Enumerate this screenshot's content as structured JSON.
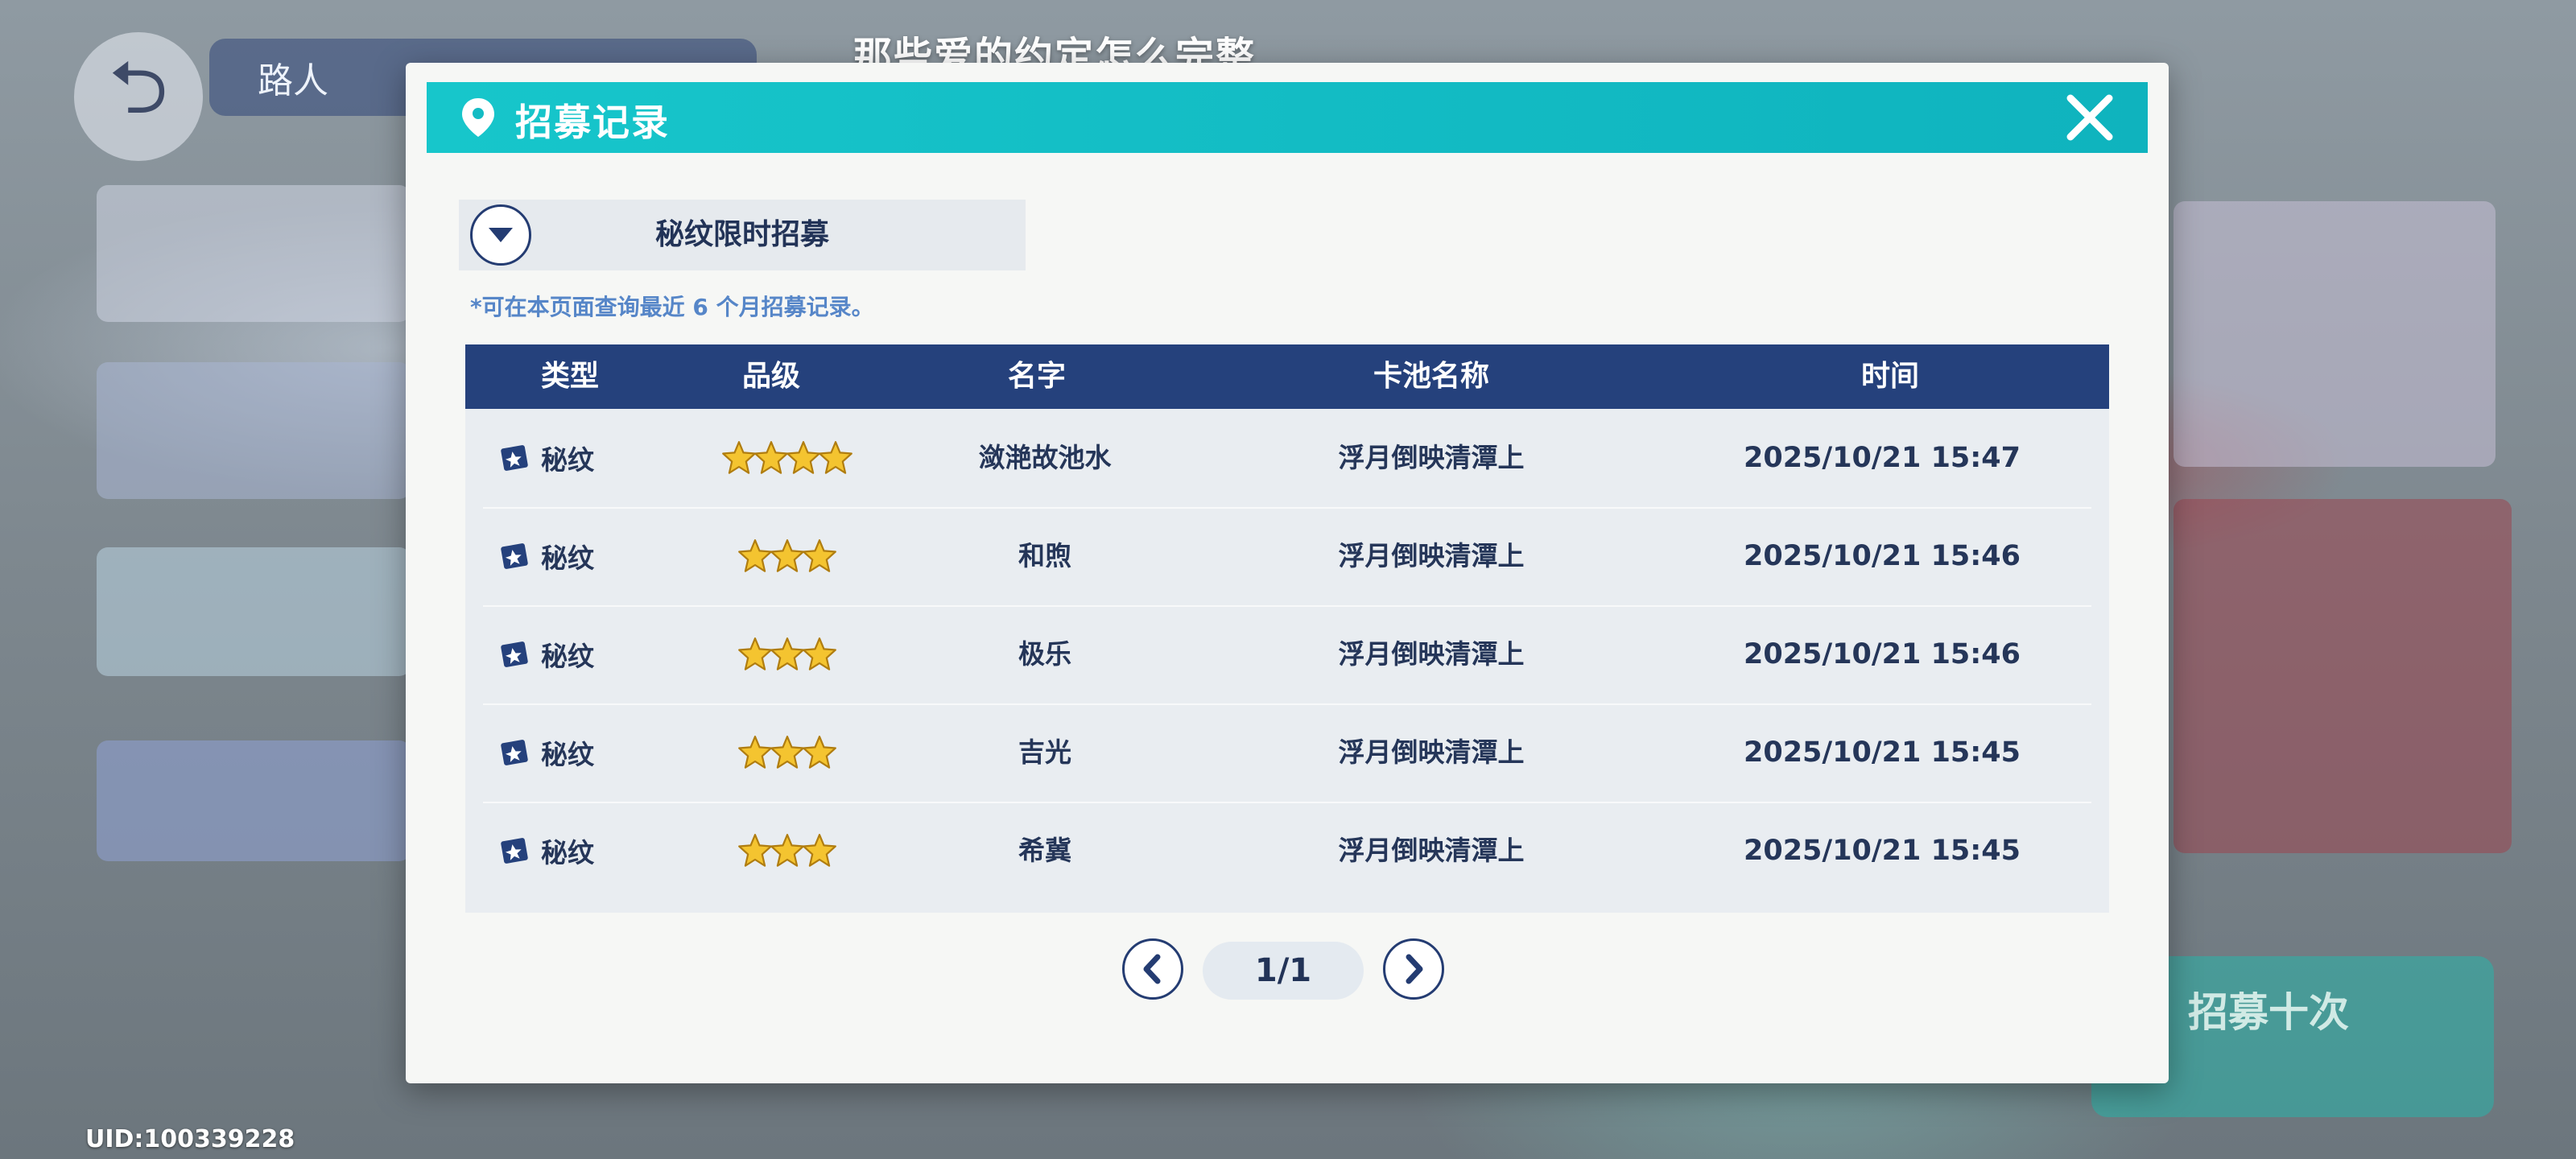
{
  "background": {
    "subtitle": "那些爱的约定怎么完整",
    "location_label": "路人",
    "uid": "UID:100339228",
    "recruit_button": "招募十次"
  },
  "dialog": {
    "title": "招募记录",
    "pool_selector": "秘纹限时招募",
    "note": "*可在本页面查询最近 6 个月招募记录。",
    "columns": [
      "类型",
      "品级",
      "名字",
      "卡池名称",
      "时间"
    ],
    "rows": [
      {
        "type": "秘纹",
        "stars": 4,
        "name": "潋滟故池水",
        "pool": "浮月倒映清潭上",
        "time": "2025/10/21 15:47"
      },
      {
        "type": "秘纹",
        "stars": 3,
        "name": "和煦",
        "pool": "浮月倒映清潭上",
        "time": "2025/10/21 15:46"
      },
      {
        "type": "秘纹",
        "stars": 3,
        "name": "极乐",
        "pool": "浮月倒映清潭上",
        "time": "2025/10/21 15:46"
      },
      {
        "type": "秘纹",
        "stars": 3,
        "name": "吉光",
        "pool": "浮月倒映清潭上",
        "time": "2025/10/21 15:45"
      },
      {
        "type": "秘纹",
        "stars": 3,
        "name": "希冀",
        "pool": "浮月倒映清潭上",
        "time": "2025/10/21 15:45"
      }
    ],
    "pagination": "1/1"
  },
  "colors": {
    "header": "#17c6cb",
    "table_header": "#25417c",
    "text_dark": "#253659",
    "note_blue": "#5686c8",
    "star": "#f4c430"
  },
  "icons": {
    "close": "close-icon",
    "location": "location-pin-icon",
    "dropdown": "chevron-down-icon",
    "type": "card-icon",
    "prev": "chevron-left-icon",
    "next": "chevron-right-icon",
    "back": "back-arrow-icon"
  }
}
